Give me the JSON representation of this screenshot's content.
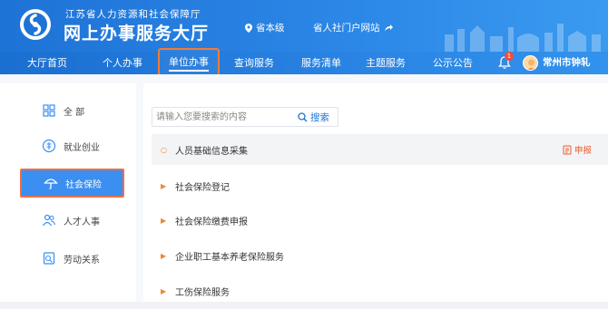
{
  "header": {
    "org_name": "江苏省人力资源和社会保障厅",
    "hall_name": "网上办事服务大厅",
    "region": "省本级",
    "portal_link": "省人社门户网站",
    "colors": {
      "primary": "#1e73d6",
      "highlight": "#ee6f45"
    }
  },
  "nav": {
    "items": [
      {
        "label": "大厅首页"
      },
      {
        "label": "个人办事"
      },
      {
        "label": "单位办事",
        "active": true
      },
      {
        "label": "查询服务"
      },
      {
        "label": "服务清单"
      },
      {
        "label": "主题服务"
      },
      {
        "label": "公示公告"
      }
    ],
    "notification_count": "1",
    "user_name": "常州市钟轧"
  },
  "sidebar": {
    "items": [
      {
        "label": "全 部",
        "icon": "grid-icon"
      },
      {
        "label": "就业创业",
        "icon": "coin-icon"
      },
      {
        "label": "社会保险",
        "icon": "umbrella-icon",
        "active": true
      },
      {
        "label": "人才人事",
        "icon": "people-icon"
      },
      {
        "label": "劳动关系",
        "icon": "document-icon"
      }
    ]
  },
  "search": {
    "placeholder": "请输入您要搜索的内容",
    "button_label": "搜索"
  },
  "services": {
    "items": [
      {
        "label": "人员基础信息采集",
        "action": "申报"
      },
      {
        "label": "社会保险登记"
      },
      {
        "label": "社会保险缴费申报"
      },
      {
        "label": "企业职工基本养老保险服务"
      },
      {
        "label": "工伤保险服务"
      }
    ]
  }
}
